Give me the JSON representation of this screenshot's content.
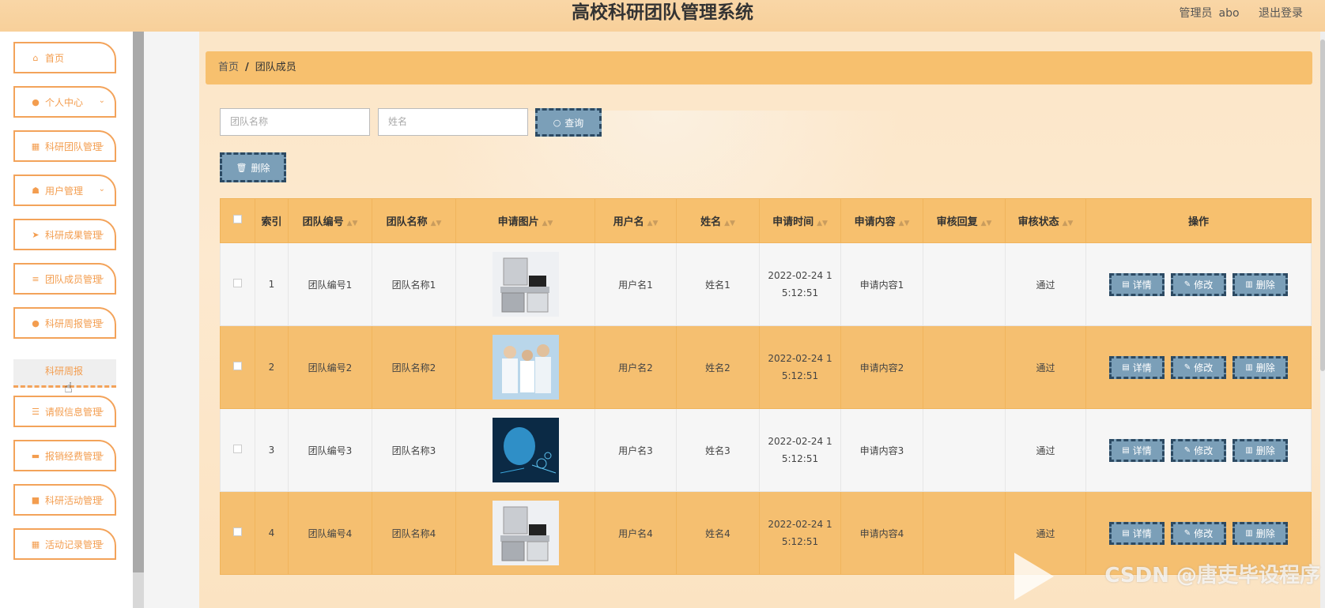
{
  "header": {
    "title": "高校科研团队管理系统",
    "role": "管理员",
    "username": "abo",
    "logout": "退出登录"
  },
  "sidebar": {
    "items": [
      {
        "label": "首页",
        "icon": "home-icon"
      },
      {
        "label": "个人中心",
        "icon": "user-icon"
      },
      {
        "label": "科研团队管理",
        "icon": "grid-icon"
      },
      {
        "label": "用户管理",
        "icon": "users-icon"
      },
      {
        "label": "科研成果管理",
        "icon": "send-icon"
      },
      {
        "label": "团队成员管理",
        "icon": "list-icon"
      },
      {
        "label": "科研周报管理",
        "icon": "user-icon"
      },
      {
        "label": "请假信息管理",
        "icon": "sliders-icon"
      },
      {
        "label": "报销经费管理",
        "icon": "ticket-icon"
      },
      {
        "label": "科研活动管理",
        "icon": "chat-icon"
      },
      {
        "label": "活动记录管理",
        "icon": "grid-icon"
      }
    ],
    "submenu_label": "科研周报"
  },
  "breadcrumb": {
    "home": "首页",
    "sep": "/",
    "current": "团队成员"
  },
  "search": {
    "team_name_placeholder": "团队名称",
    "name_placeholder": "姓名",
    "query_label": "查询",
    "delete_label": "删除"
  },
  "table": {
    "columns": [
      "索引",
      "团队编号",
      "团队名称",
      "申请图片",
      "用户名",
      "姓名",
      "申请时间",
      "申请内容",
      "审核回复",
      "审核状态",
      "操作"
    ],
    "rows": [
      {
        "index": "1",
        "team_no": "团队编号1",
        "team_name": "团队名称1",
        "image": "lab-equipment",
        "username": "用户名1",
        "name": "姓名1",
        "time_a": "2022-02-24 1",
        "time_b": "5:12:51",
        "content": "申请内容1",
        "reply": "",
        "status": "通过"
      },
      {
        "index": "2",
        "team_no": "团队编号2",
        "team_name": "团队名称2",
        "image": "scientists",
        "username": "用户名2",
        "name": "姓名2",
        "time_a": "2022-02-24 1",
        "time_b": "5:12:51",
        "content": "申请内容2",
        "reply": "",
        "status": "通过"
      },
      {
        "index": "3",
        "team_no": "团队编号3",
        "team_name": "团队名称3",
        "image": "ai-head",
        "username": "用户名3",
        "name": "姓名3",
        "time_a": "2022-02-24 1",
        "time_b": "5:12:51",
        "content": "申请内容3",
        "reply": "",
        "status": "通过"
      },
      {
        "index": "4",
        "team_no": "团队编号4",
        "team_name": "团队名称4",
        "image": "lab-equipment",
        "username": "用户名4",
        "name": "姓名4",
        "time_a": "2022-02-24 1",
        "time_b": "5:12:51",
        "content": "申请内容4",
        "reply": "",
        "status": "通过"
      }
    ],
    "actions": {
      "detail": "详情",
      "edit": "修改",
      "delete": "删除"
    }
  },
  "watermark": "CSDN @唐吏毕设程序",
  "colors": {
    "accent": "#f7c06e",
    "button": "#7b9fb8",
    "button_border": "#2c4a63",
    "menu_border": "#f3a35a"
  }
}
